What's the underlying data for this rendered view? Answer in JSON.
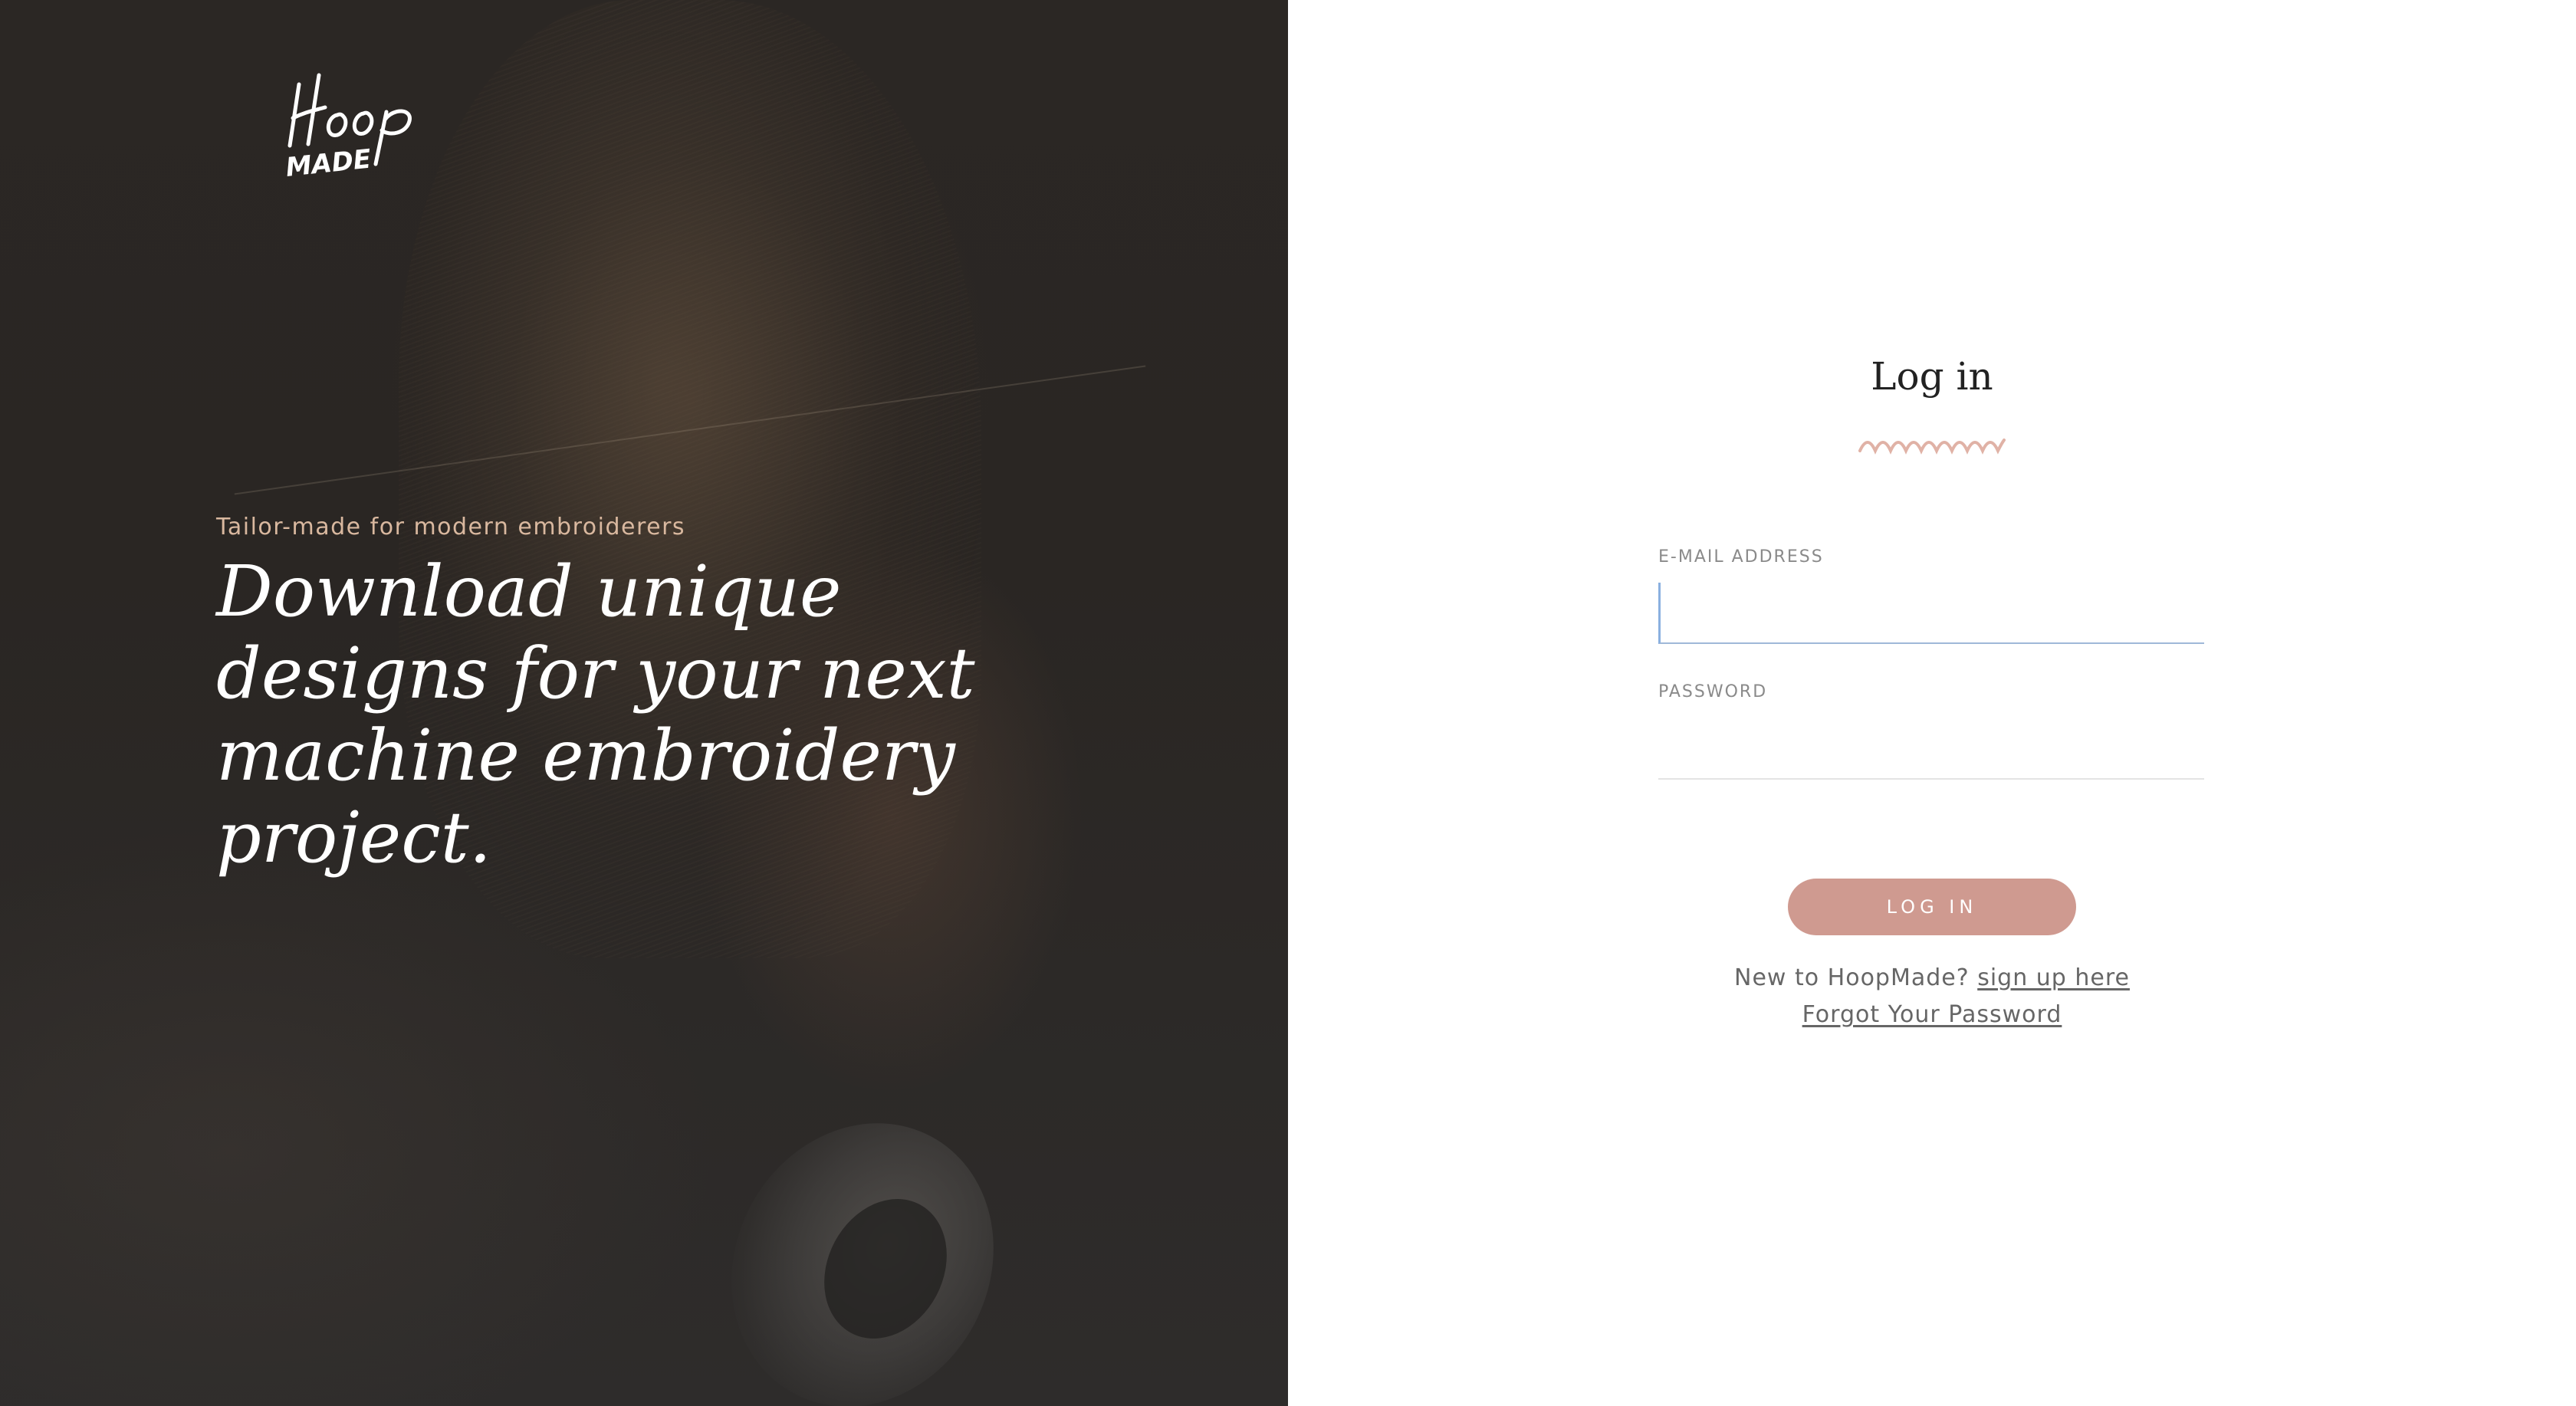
{
  "hero": {
    "logo_alt": "Hoop MADE",
    "logo_line1": "Hoop",
    "logo_line2": "MADE",
    "tagline": "Tailor-made for modern embroiderers",
    "headline": "Download unique designs for your next machine embroidery project."
  },
  "form": {
    "title": "Log in",
    "email_label": "E-MAIL ADDRESS",
    "email_value": "",
    "password_label": "PASSWORD",
    "password_value": "",
    "submit_label": "LOG IN",
    "signup_prompt": "New to HoopMade?",
    "signup_link": "sign up here",
    "forgot_link": "Forgot Your Password"
  },
  "colors": {
    "accent": "#cf9a90",
    "hero_bg": "#2b2724",
    "tagline": "#d9b89f",
    "focus": "#8ab0e0"
  },
  "icons": {
    "divider": "squiggle-divider-icon",
    "logo": "hoopmade-logo"
  }
}
